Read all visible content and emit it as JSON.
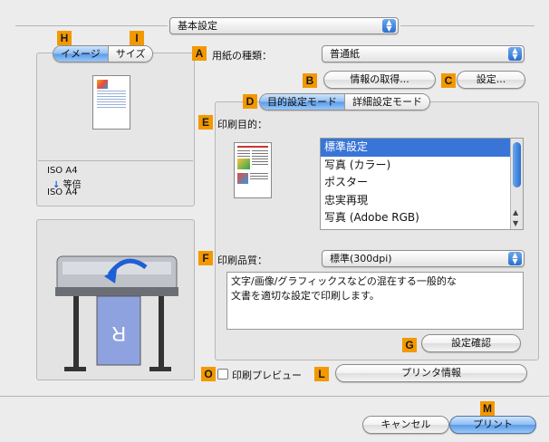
{
  "top_popup": {
    "value": "基本設定"
  },
  "badges": {
    "H": "H",
    "I": "I",
    "A": "A",
    "B": "B",
    "C": "C",
    "D": "D",
    "E": "E",
    "F": "F",
    "G": "G",
    "O": "O",
    "L": "L",
    "M": "M"
  },
  "left_tabs": {
    "image": "イメージ",
    "size": "サイズ"
  },
  "preview_info": {
    "paper": "ISO A4",
    "scale": "等倍",
    "output": "ISO A4"
  },
  "paper_type": {
    "label": "用紙の種類：",
    "value": "普通紙"
  },
  "buttons": {
    "get_info": "情報の取得...",
    "settings": "設定...",
    "confirm_settings": "設定確認",
    "printer_info": "プリンタ情報",
    "cancel": "キャンセル",
    "print": "プリント"
  },
  "mode_tabs": {
    "purpose_mode": "目的設定モード",
    "detail_mode": "詳細設定モード"
  },
  "print_purpose": {
    "label": "印刷目的：",
    "items": [
      "標準設定",
      "写真 (カラー)",
      "ポスター",
      "忠実再現",
      "写真 (Adobe RGB)"
    ],
    "selected_index": 0
  },
  "print_quality": {
    "label": "印刷品質：",
    "value": "標準(300dpi)"
  },
  "description": {
    "line1": "文字/画像/グラフィックスなどの混在する一般的な",
    "line2": "文書を適切な設定で印刷します。"
  },
  "preview_checkbox": {
    "label": "印刷プレビュー",
    "checked": false
  },
  "colors": {
    "badge": "#f39800",
    "selection": "#3875d7",
    "accent_blue": "#5a9ae8"
  }
}
